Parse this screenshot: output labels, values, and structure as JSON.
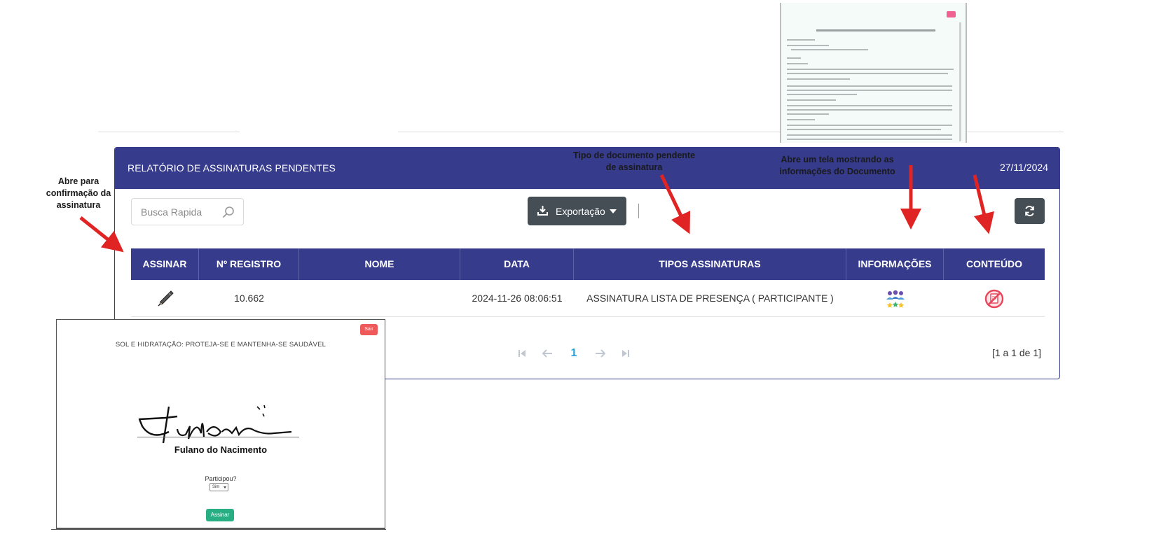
{
  "panel": {
    "title": "RELATÓRIO DE ASSINATURAS PENDENTES",
    "date": "27/11/2024"
  },
  "toolbar": {
    "search_placeholder": "Busca Rapida",
    "export_label": "Exportação"
  },
  "table": {
    "headers": [
      "ASSINAR",
      "Nº REGISTRO",
      "NOME",
      "DATA",
      "TIPOS ASSINATURAS",
      "INFORMAÇÕES",
      "CONTEÚDO"
    ],
    "rows": [
      {
        "registro": "10.662",
        "nome": "",
        "data": "2024-11-26 08:06:51",
        "tipo": "ASSINATURA LISTA DE PRESENÇA ( PARTICIPANTE )"
      }
    ]
  },
  "pagination": {
    "current_page": "1",
    "count_text": "[1 a 1 de 1]"
  },
  "annotations": {
    "assinar_line1": "Abre para",
    "assinar_line2": "confirmação da",
    "assinar_line3": "assinatura",
    "tipo_line1": "Tipo de documento pendente",
    "tipo_line2": "de assinatura",
    "info_line1": "Abre um tela mostrando as",
    "info_line2": "informações do Documento"
  },
  "modal": {
    "exit_label": "Sair",
    "document_title": "SOL E HIDRATAÇÃO: PROTEJA-SE E MANTENHA-SE SAUDÁVEL",
    "signer_name": "Fulano do Nacimento",
    "participou_label": "Participou?",
    "participou_value": "Sim",
    "assinar_label": "Assinar"
  },
  "colors": {
    "primary": "#363b8c",
    "button_dark": "#454d55",
    "arrow_red": "#e02424",
    "page_active": "#2b9fd8",
    "assinar_green": "#27ae83",
    "exit_red": "#ee5a5a"
  },
  "icons": {
    "assinar": "pencil-icon",
    "informacoes": "people-group-icon",
    "conteudo": "document-blocked-icon",
    "search": "search-icon",
    "export": "download-icon",
    "refresh": "refresh-icon"
  }
}
